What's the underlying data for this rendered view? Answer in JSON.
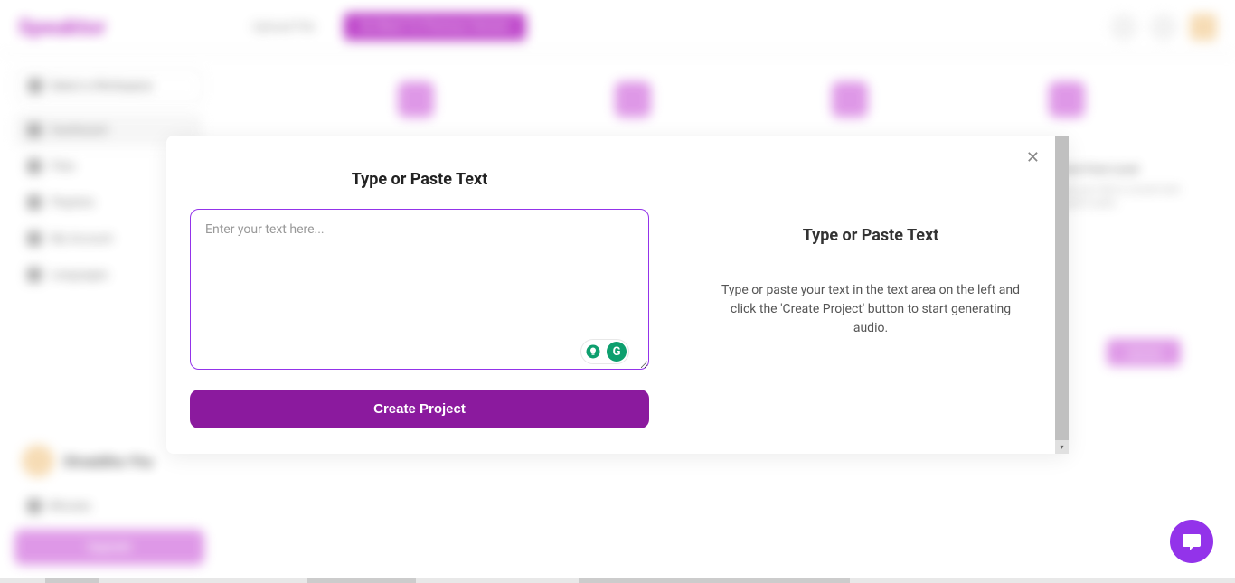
{
  "header": {
    "logo": "Speaktor",
    "upload_file": "Upload File",
    "purple_btn": "Go Back To Previous Version"
  },
  "sidebar": {
    "workspace": "Select a Workspace",
    "nav": [
      "Dashboard",
      "Files",
      "Playlists",
      "My Account",
      "Languages"
    ],
    "username": "Shraddha Yha",
    "minutes": "Minutes",
    "upgrade": "Upgrade"
  },
  "modal": {
    "left_title": "Type or Paste Text",
    "placeholder": "Enter your text here...",
    "create_btn": "Create Project",
    "right_title": "Type or Paste Text",
    "right_text": "Type or paste your text in the text area on the left and click the 'Create Project' button to start generating audio."
  },
  "bg_right": {
    "title": "Browse From Local",
    "upload": "Upload"
  }
}
